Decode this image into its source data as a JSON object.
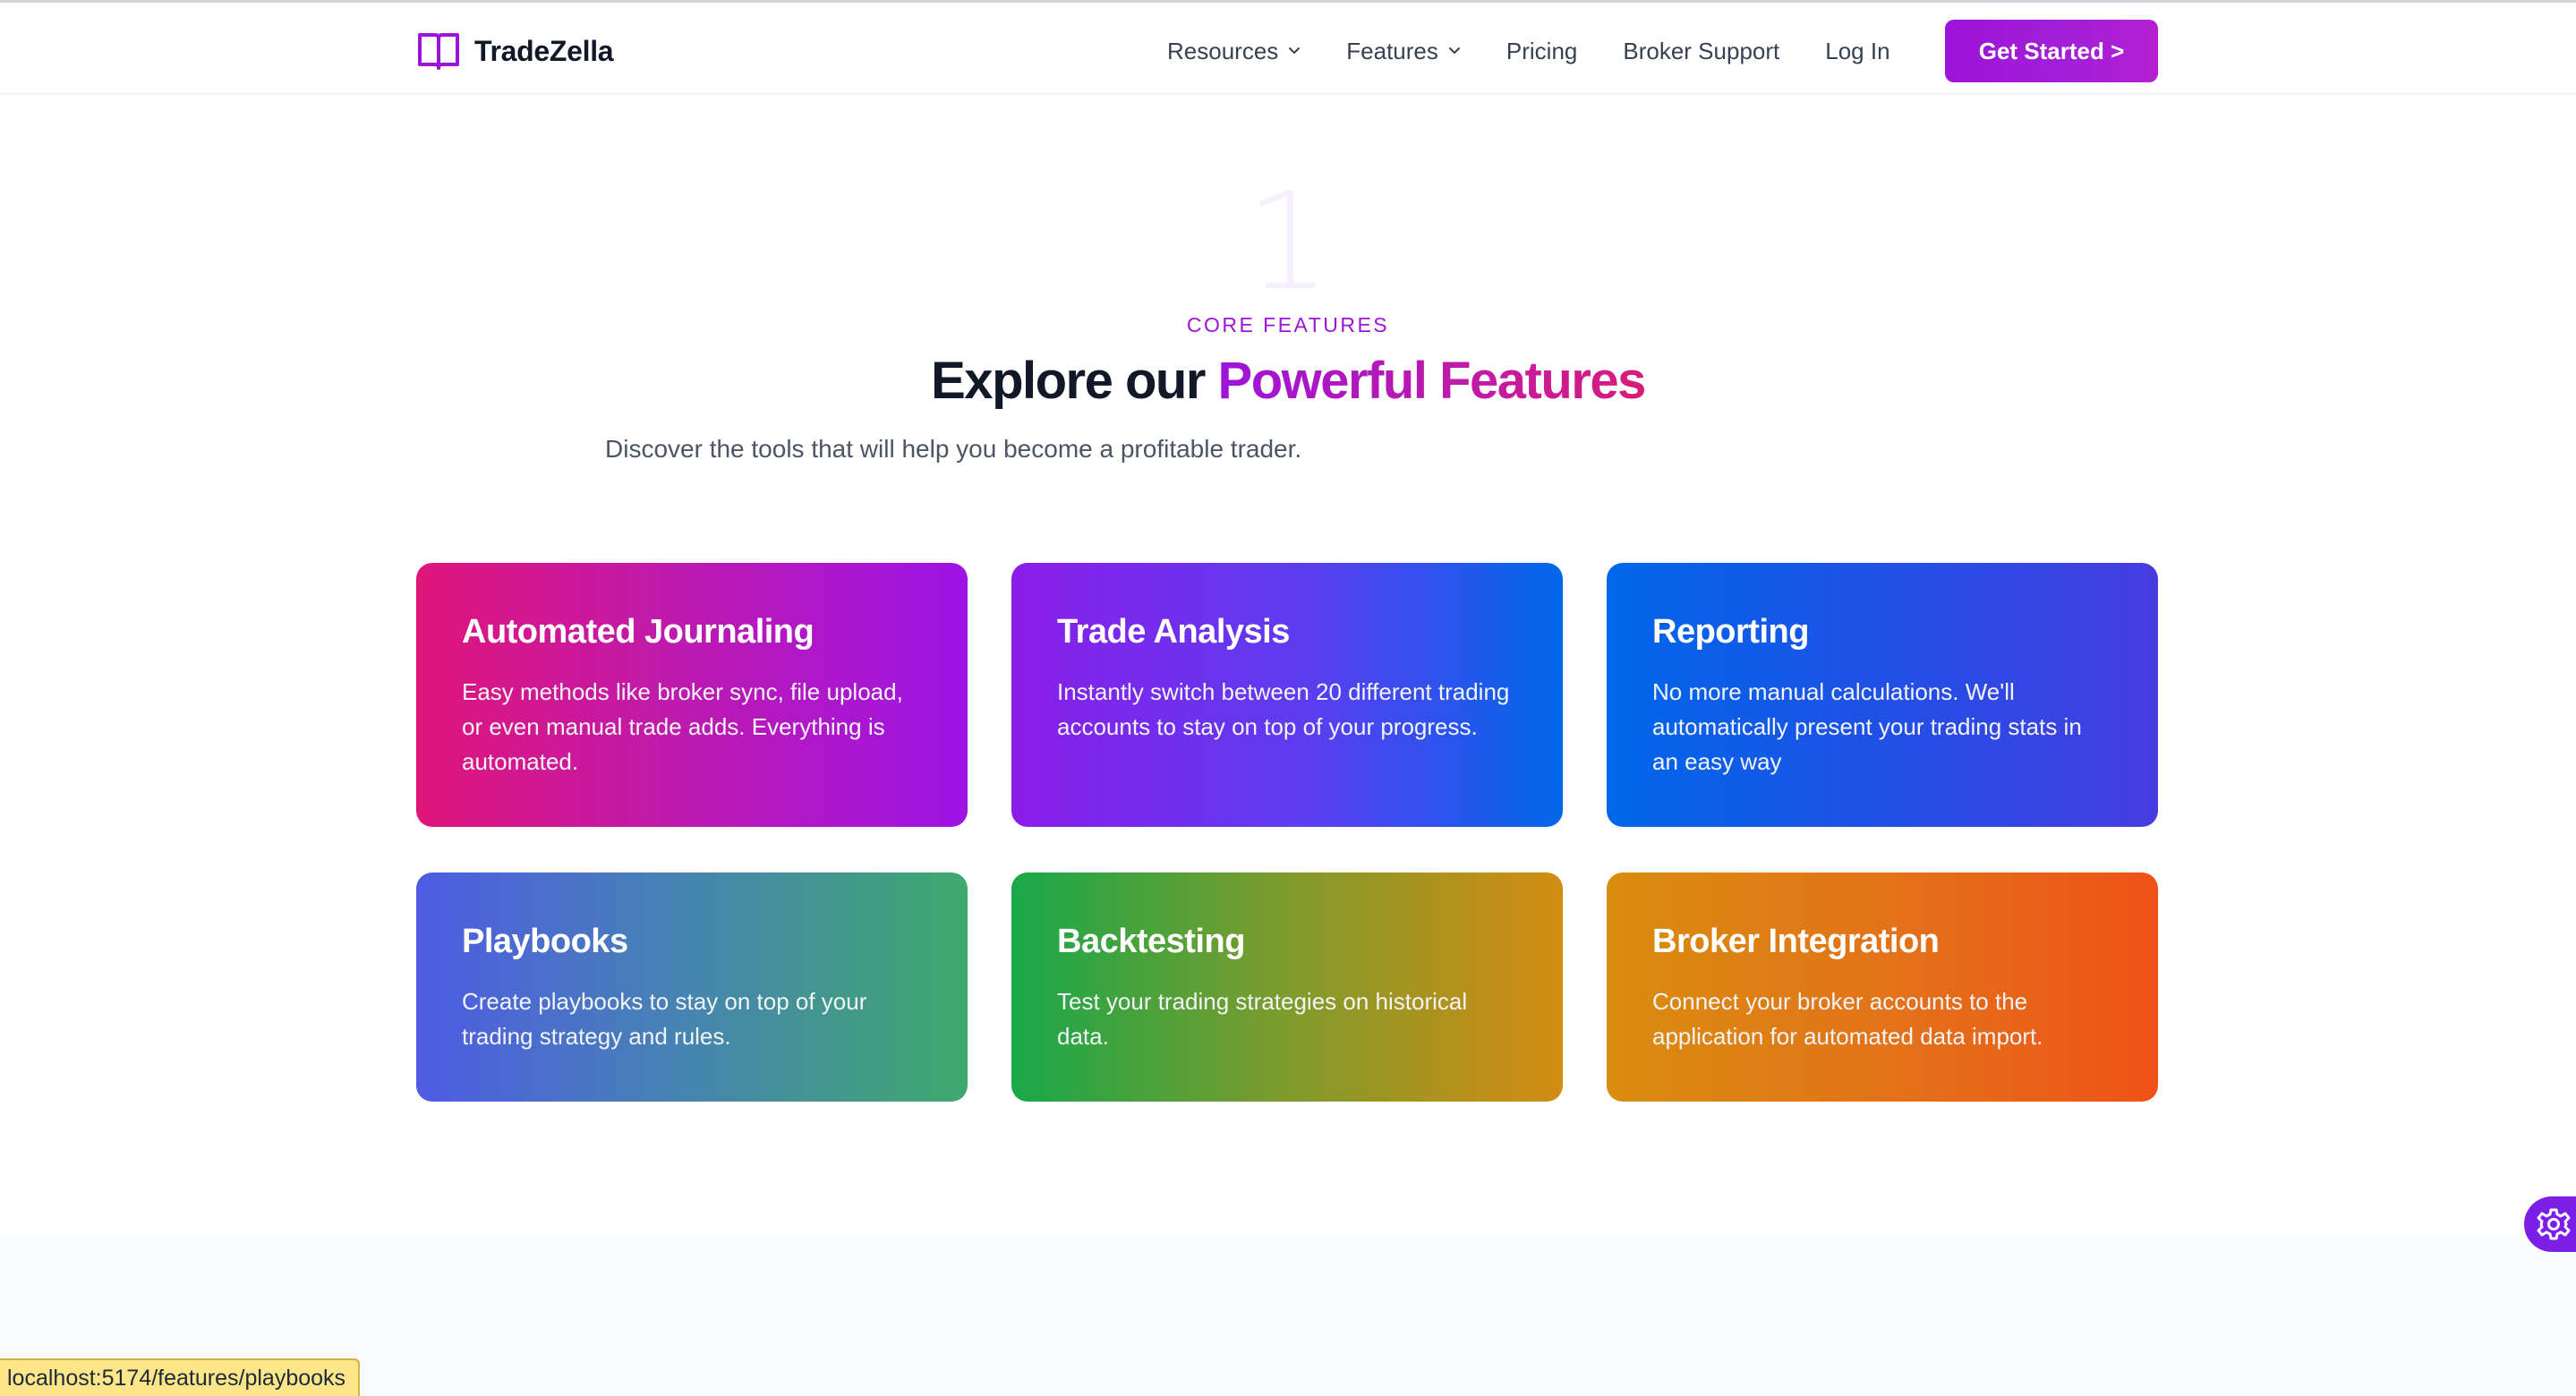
{
  "brand": {
    "name": "TradeZella",
    "icon": "open-book-icon",
    "accent_color": "#9d14d9"
  },
  "nav": {
    "items": [
      {
        "label": "Resources",
        "has_dropdown": true
      },
      {
        "label": "Features",
        "has_dropdown": true
      },
      {
        "label": "Pricing",
        "has_dropdown": false
      },
      {
        "label": "Broker Support",
        "has_dropdown": false
      },
      {
        "label": "Log In",
        "has_dropdown": false
      }
    ],
    "cta_label": "Get Started >"
  },
  "hero": {
    "big_number": "1",
    "eyebrow": "CORE FEATURES",
    "headline_plain": "Explore our",
    "headline_accent": "Powerful Features",
    "subheadline": "Discover the tools that will help you become a profitable trader."
  },
  "features": [
    {
      "title": "Automated Journaling",
      "description": "Easy methods like broker sync, file upload, or even manual trade adds. Everything is automated.",
      "colors": [
        "#e0157a",
        "#9d14e6"
      ]
    },
    {
      "title": "Trade Analysis",
      "description": "Instantly switch between 20 different trading accounts to stay on top of your progress.",
      "colors": [
        "#8b1de9",
        "#0067ea"
      ]
    },
    {
      "title": "Reporting",
      "description": "No more manual calculations. We'll automatically present your trading stats in an easy way",
      "colors": [
        "#0067ea",
        "#463ce0"
      ]
    },
    {
      "title": "Playbooks",
      "description": "Create playbooks to stay on top of your trading strategy and rules.",
      "colors": [
        "#4e5be3",
        "#3fa96c"
      ]
    },
    {
      "title": "Backtesting",
      "description": "Test your trading strategies on historical data.",
      "colors": [
        "#18a84a",
        "#d48b12"
      ]
    },
    {
      "title": "Broker Integration",
      "description": "Connect your broker accounts to the application for automated data import.",
      "colors": [
        "#d98d0e",
        "#ee5216"
      ]
    }
  ],
  "floating_button": {
    "icon": "gear-icon"
  },
  "status_bar": {
    "url": "localhost:5174/features/playbooks"
  }
}
